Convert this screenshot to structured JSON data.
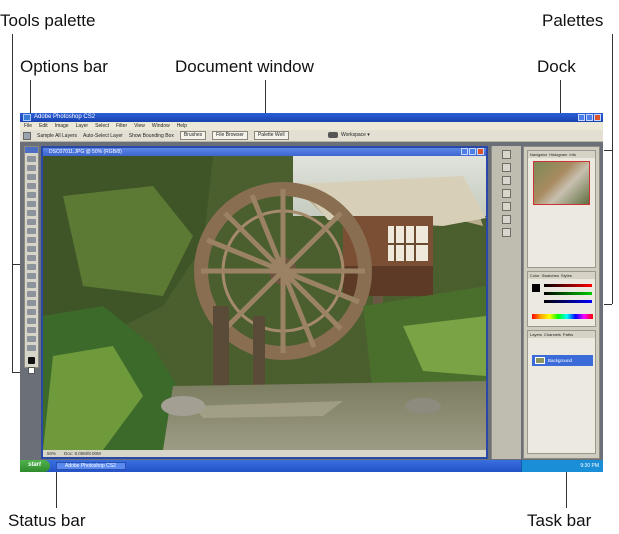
{
  "callouts": {
    "tools_palette": "Tools palette",
    "options_bar": "Options bar",
    "document_window": "Document window",
    "palettes": "Palettes",
    "dock": "Dock",
    "status_bar": "Status bar",
    "task_bar": "Task bar"
  },
  "app": {
    "title": "Adobe Photoshop CS2",
    "menus": [
      "File",
      "Edit",
      "Image",
      "Layer",
      "Select",
      "Filter",
      "View",
      "Window",
      "Help"
    ]
  },
  "options": {
    "labels": [
      "Sample All Layers",
      "Auto-Select Layer",
      "Show Bounding Box"
    ],
    "buttons": [
      "Brushes",
      "File Browser",
      "Palette Well"
    ],
    "workspace": "Workspace ▾"
  },
  "document": {
    "title": "DSC07011.JPG @ 50% (RGB/8)",
    "status_zoom": "50%",
    "status_info": "Doc: 8.00M/8.00M"
  },
  "palettes": {
    "navigator_tabs": [
      "Navigator",
      "Histogram",
      "Info"
    ],
    "color_tabs": [
      "Color",
      "Swatches",
      "Styles"
    ],
    "layers_tabs": [
      "Layers",
      "Channels",
      "Paths"
    ],
    "layer_name": "Background"
  },
  "taskbar": {
    "start": "start",
    "app": "Adobe Photoshop CS2",
    "time": "9:30 PM"
  }
}
